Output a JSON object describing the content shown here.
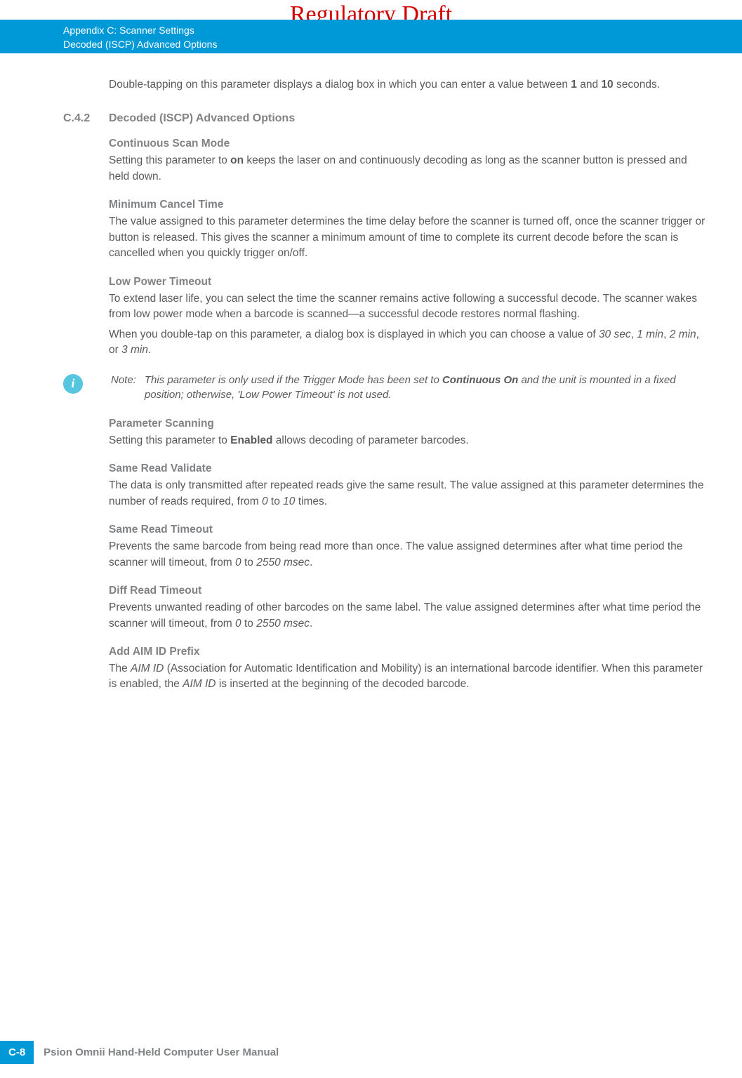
{
  "watermark": "Regulatory Draft",
  "header": {
    "line1": "Appendix C: Scanner Settings",
    "line2": "Decoded (ISCP) Advanced Options"
  },
  "intro": {
    "p1a": "Double-tapping on this parameter displays a dialog box in which you can enter a value between ",
    "v1": "1",
    "p1b": " and ",
    "v10": "10",
    "p1c": " seconds."
  },
  "section": {
    "num": "C.4.2",
    "title": "Decoded (ISCP) Advanced Options"
  },
  "csm": {
    "title": "Continuous Scan Mode",
    "p1a": "Setting this parameter to ",
    "on": "on",
    "p1b": " keeps the laser on and continuously decoding as long as the scanner button is pressed and held down."
  },
  "mct": {
    "title": "Minimum Cancel Time",
    "p1": "The value assigned to this parameter determines the time delay before the scanner is turned off, once the scanner trigger or button is released. This gives the scanner a minimum amount of time to complete its current decode before the scan is cancelled when you quickly trigger on/off."
  },
  "lpt": {
    "title": "Low Power Timeout",
    "p1": "To extend laser life, you can select the time the scanner remains active following a successful decode. The scanner wakes from low power mode when a barcode is scanned—a successful decode restores normal flashing.",
    "p2a": "When you double-tap on this parameter, a dialog box is displayed in which you can choose a value of ",
    "v30": "30 sec",
    "c1": ", ",
    "v1m": "1 min",
    "c2": ", ",
    "v2m": "2 min",
    "c3": ", or ",
    "v3m": "3 min",
    "p2b": "."
  },
  "note": {
    "label": "Note:",
    "t1": "This parameter is only used if the Trigger Mode has been set to ",
    "co": "Continuous On",
    "t2": " and the unit is mounted in a fixed position; otherwise, 'Low Power Timeout' is not used."
  },
  "ps": {
    "title": "Parameter Scanning",
    "p1a": "Setting this parameter to ",
    "en": "Enabled",
    "p1b": " allows decoding of parameter barcodes."
  },
  "srv": {
    "title": "Same Read Validate",
    "p1a": "The data is only transmitted after repeated reads give the same result. The value assigned at this parameter determines the number of reads required, from ",
    "v0": "0",
    "p1b": " to ",
    "v10": "10",
    "p1c": " times."
  },
  "srt": {
    "title": "Same Read Timeout",
    "p1a": "Prevents the same barcode from being read more than once. The value assigned determines after what time period the scanner will timeout, from ",
    "v0": "0",
    "p1b": " to ",
    "v2550": "2550 msec",
    "p1c": "."
  },
  "drt": {
    "title": "Diff Read Timeout",
    "p1a": "Prevents unwanted reading of other barcodes on the same label. The value assigned determines after what time period the scanner will timeout, from ",
    "v0": "0",
    "p1b": " to ",
    "v2550": "2550 msec",
    "p1c": "."
  },
  "aim": {
    "title": "Add AIM ID Prefix",
    "p1a": "The ",
    "aimid1": "AIM ID",
    "p1b": " (Association for Automatic Identification and Mobility) is an international barcode identifier. When this parameter is enabled, the ",
    "aimid2": "AIM ID",
    "p1c": " is inserted at the beginning of the decoded barcode."
  },
  "footer": {
    "page": "C-8",
    "title": "Psion Omnii Hand-Held Computer User Manual"
  }
}
